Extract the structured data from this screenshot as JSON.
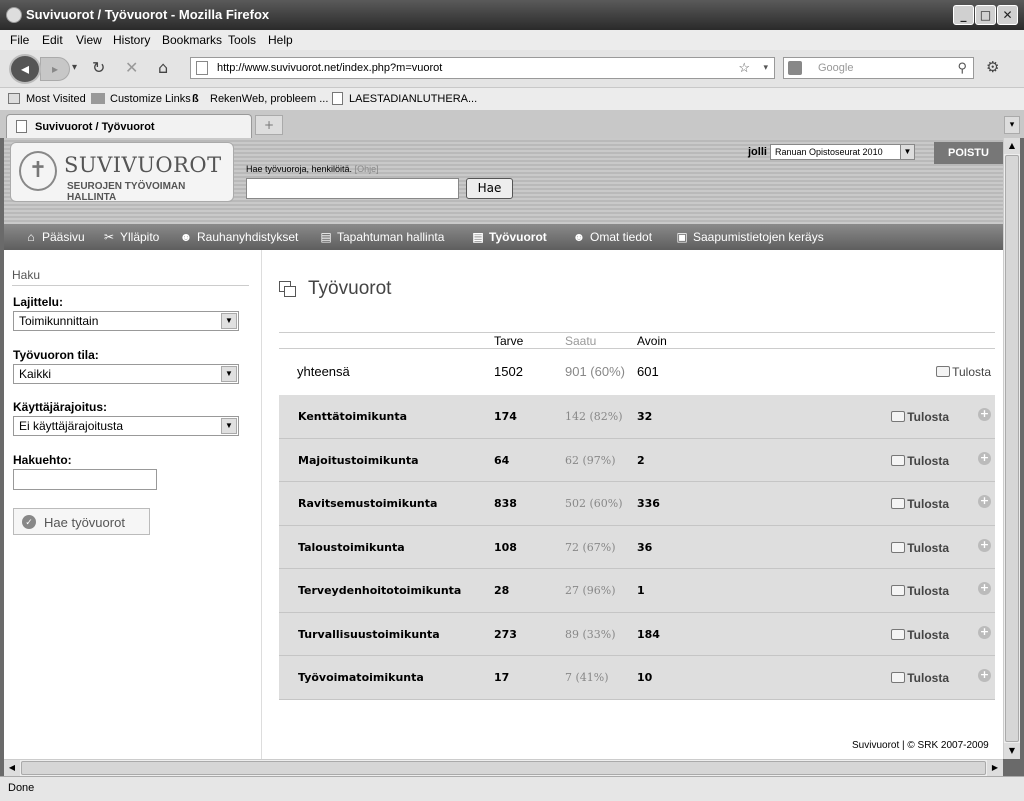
{
  "window": {
    "title": "Suvivuorot / Työvuorot - Mozilla Firefox"
  },
  "menu": [
    "File",
    "Edit",
    "View",
    "History",
    "Bookmarks",
    "Tools",
    "Help"
  ],
  "browser": {
    "url": "http://www.suvivuorot.net/index.php?m=vuorot",
    "search_placeholder": "Google",
    "bookmarks": [
      "Most Visited",
      "Customize Links",
      "RekenWeb, probleem ...",
      "LAESTADIANLUTHERA..."
    ],
    "tab_title": "Suvivuorot / Työvuorot",
    "status": "Done"
  },
  "site": {
    "logo_name": "SUVIVUOROT",
    "logo_sub": "SEUROJEN TYÖVOIMAN HALLINTA",
    "search_label": "Hae työvuoroja, henkilöitä.",
    "search_help": "[Ohje]",
    "search_button": "Hae",
    "user": "jolli",
    "event": "Ranuan Opistoseurat 2010",
    "logout": "POISTU"
  },
  "nav": [
    {
      "label": "Pääsivu",
      "icon": "home-icon"
    },
    {
      "label": "Ylläpito",
      "icon": "tools-icon"
    },
    {
      "label": "Rauhanyhdistykset",
      "icon": "people-icon"
    },
    {
      "label": "Tapahtuman hallinta",
      "icon": "event-icon"
    },
    {
      "label": "Työvuorot",
      "icon": "shifts-icon"
    },
    {
      "label": "Omat tiedot",
      "icon": "user-icon"
    },
    {
      "label": "Saapumistietojen keräys",
      "icon": "arrivals-icon"
    }
  ],
  "sidebar": {
    "title": "Haku",
    "sort_label": "Lajittelu:",
    "sort_value": "Toimikunnittain",
    "state_label": "Työvuoron tila:",
    "state_value": "Kaikki",
    "user_limit_label": "Käyttäjärajoitus:",
    "user_limit_value": "Ei käyttäjärajoitusta",
    "criteria_label": "Hakuehto:",
    "criteria_value": "",
    "submit": "Hae työvuorot"
  },
  "content": {
    "title": "Työvuorot",
    "columns": {
      "need": "Tarve",
      "got": "Saatu",
      "open": "Avoin"
    },
    "total": {
      "label": "yhteensä",
      "need": "1502",
      "got": "901 (60%)",
      "open": "601",
      "print": "Tulosta"
    },
    "rows": [
      {
        "name": "Kenttätoimikunta",
        "need": "174",
        "got": "142 (82%)",
        "open": "32",
        "print": "Tulosta"
      },
      {
        "name": "Majoitustoimikunta",
        "need": "64",
        "got": "62 (97%)",
        "open": "2",
        "print": "Tulosta"
      },
      {
        "name": "Ravitsemustoimikunta",
        "need": "838",
        "got": "502 (60%)",
        "open": "336",
        "print": "Tulosta"
      },
      {
        "name": "Taloustoimikunta",
        "need": "108",
        "got": "72 (67%)",
        "open": "36",
        "print": "Tulosta"
      },
      {
        "name": "Terveydenhoitotoimikunta",
        "need": "28",
        "got": "27 (96%)",
        "open": "1",
        "print": "Tulosta"
      },
      {
        "name": "Turvallisuustoimikunta",
        "need": "273",
        "got": "89 (33%)",
        "open": "184",
        "print": "Tulosta"
      },
      {
        "name": "Työvoimatoimikunta",
        "need": "17",
        "got": "7 (41%)",
        "open": "10",
        "print": "Tulosta"
      }
    ],
    "footer": "Suvivuorot | © SRK 2007-2009"
  }
}
